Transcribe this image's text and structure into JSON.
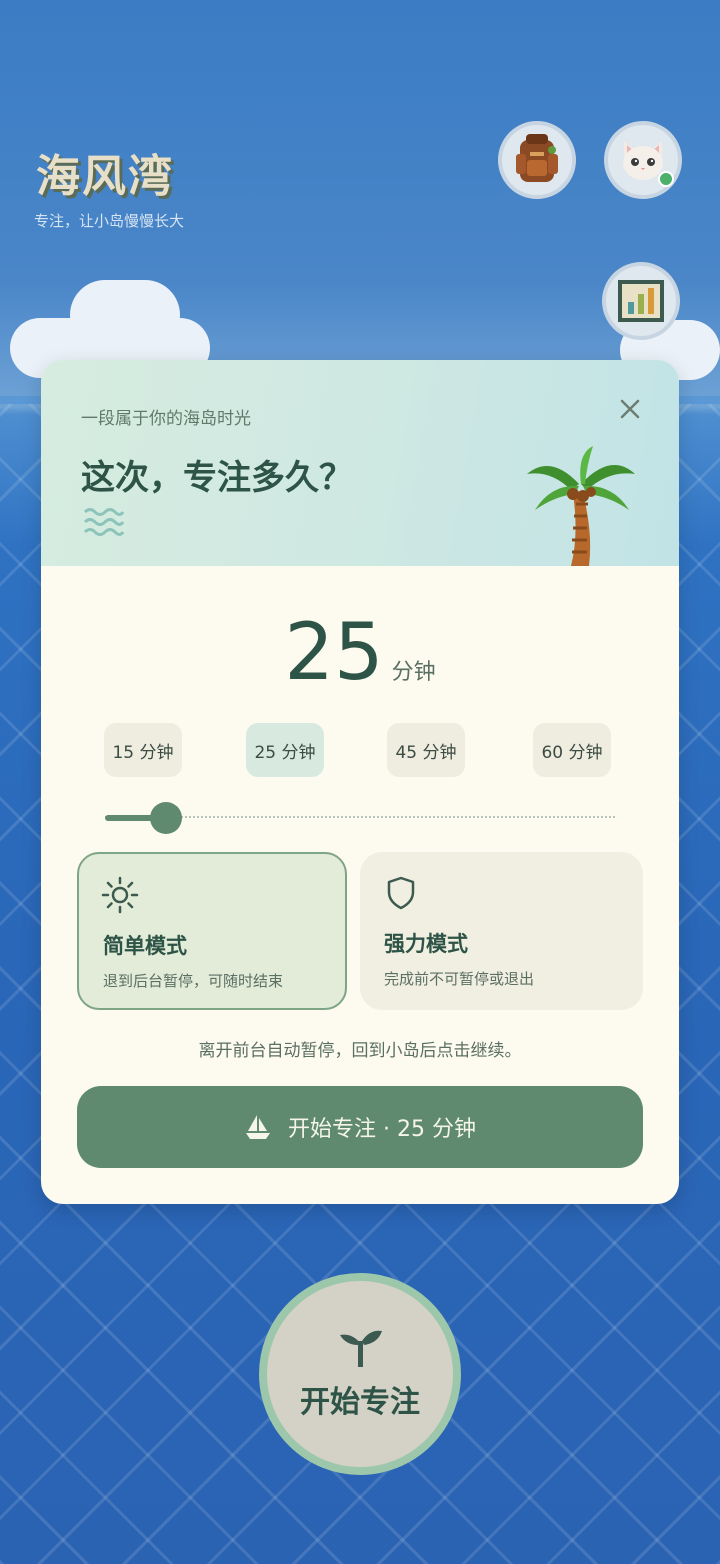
{
  "app": {
    "title": "海风湾",
    "subtitle": "专注，让小岛慢慢长大"
  },
  "header_buttons": {
    "backpack_icon": "backpack-icon",
    "avatar_icon": "cat-avatar-icon",
    "stats_icon": "bar-chart-icon"
  },
  "modal": {
    "eyebrow": "一段属于你的海岛时光",
    "headline": "这次，专注多久？",
    "duration_value": "25",
    "duration_unit": "分钟",
    "presets": [
      {
        "label": "15 分钟",
        "selected": false
      },
      {
        "label": "25 分钟",
        "selected": true
      },
      {
        "label": "45 分钟",
        "selected": false
      },
      {
        "label": "60 分钟",
        "selected": false
      }
    ],
    "slider_level": 0.12,
    "modes": [
      {
        "title": "简单模式",
        "desc": "退到后台暂停，可随时结束",
        "icon": "sun-icon",
        "selected": true
      },
      {
        "title": "强力模式",
        "desc": "完成前不可暂停或退出",
        "icon": "shield-icon",
        "selected": false
      }
    ],
    "hint": "离开前台自动暂停，回到小岛后点击继续。",
    "cta_label": "开始专注 · 25 分钟"
  },
  "fab": {
    "label": "开始专注",
    "icon": "sprout-icon"
  },
  "colors": {
    "accent": "#5f8a6f",
    "text_dark": "#2e5447",
    "card_bg": "#fdfbef"
  }
}
